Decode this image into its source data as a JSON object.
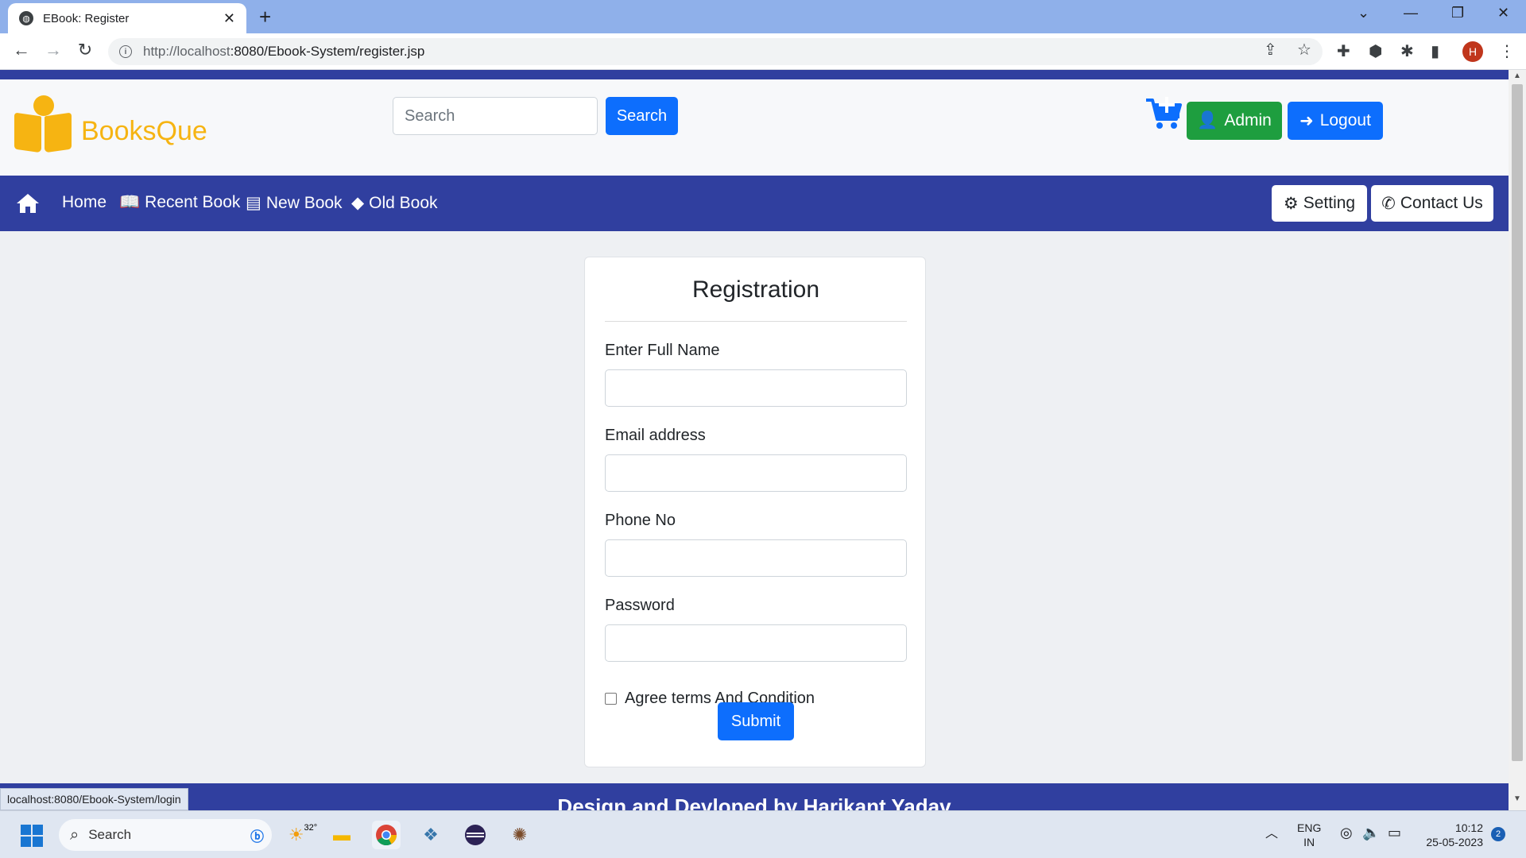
{
  "browser": {
    "tab_title": "EBook: Register",
    "url_host": "http://localhost",
    "url_rest": ":8080/Ebook-System/register.jsp",
    "profile_initial": "H",
    "status_url": "localhost:8080/Ebook-System/login"
  },
  "header": {
    "brand": "BooksQue",
    "search_placeholder": "Search",
    "search_button": "Search",
    "admin_button": "Admin",
    "logout_button": "Logout"
  },
  "nav": {
    "home": "Home",
    "recent_book": "Recent Book",
    "new_book": "New Book",
    "old_book": "Old Book",
    "setting": "Setting",
    "contact_us": "Contact Us"
  },
  "form": {
    "title": "Registration",
    "full_name_label": "Enter Full Name",
    "email_label": "Email address",
    "phone_label": "Phone No",
    "password_label": "Password",
    "agree_label": "Agree terms And Condition",
    "submit_button": "Submit"
  },
  "footer": {
    "text": "Design and Devloped by Harikant Yadav"
  },
  "taskbar": {
    "search_label": "Search",
    "weather": "32°",
    "lang_line1": "ENG",
    "lang_line2": "IN",
    "time": "10:12",
    "date": "25-05-2023",
    "notification_count": "2"
  },
  "colors": {
    "brand_navy": "#303f9f",
    "brand_yellow": "#f6b412",
    "primary_blue": "#0d6efd",
    "success_green": "#1e9e3f"
  }
}
